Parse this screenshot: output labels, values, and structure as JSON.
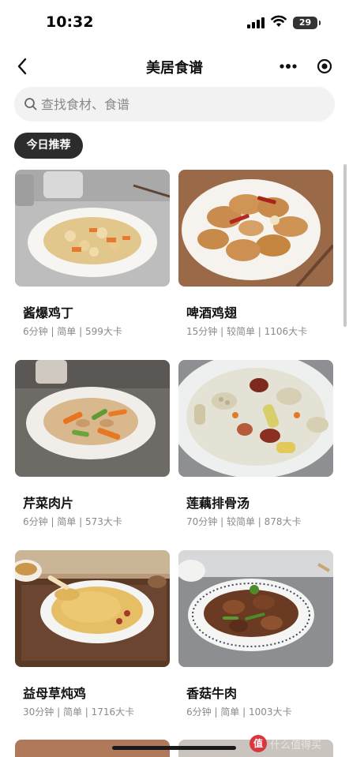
{
  "status_bar": {
    "time": "10:32",
    "battery": "29"
  },
  "nav": {
    "title": "美居食谱"
  },
  "search": {
    "placeholder": "查找食材、食谱"
  },
  "tag": {
    "label": "今日推荐"
  },
  "cards": [
    {
      "title": "酱爆鸡丁",
      "meta": "6分钟 | 简单 | 599大卡"
    },
    {
      "title": "啤酒鸡翅",
      "meta": "15分钟 | 较简单 | 1106大卡"
    },
    {
      "title": "芹菜肉片",
      "meta": "6分钟 | 简单 | 573大卡"
    },
    {
      "title": "莲藕排骨汤",
      "meta": "70分钟 | 较简单 | 878大卡"
    },
    {
      "title": "益母草炖鸡",
      "meta": "30分钟 | 简单 | 1716大卡"
    },
    {
      "title": "香菇牛肉",
      "meta": "6分钟 | 简单 | 1003大卡"
    }
  ],
  "watermark": {
    "logo": "值",
    "text": "什么值得买"
  },
  "icons": {
    "back": "chevron-left-icon",
    "more": "more-dots-icon",
    "close": "target-circle-icon",
    "search": "search-icon"
  },
  "colors": {
    "tag_background": "#2c2c2c",
    "search_background": "#f2f2f2",
    "meta_text": "#8a8a8a"
  }
}
